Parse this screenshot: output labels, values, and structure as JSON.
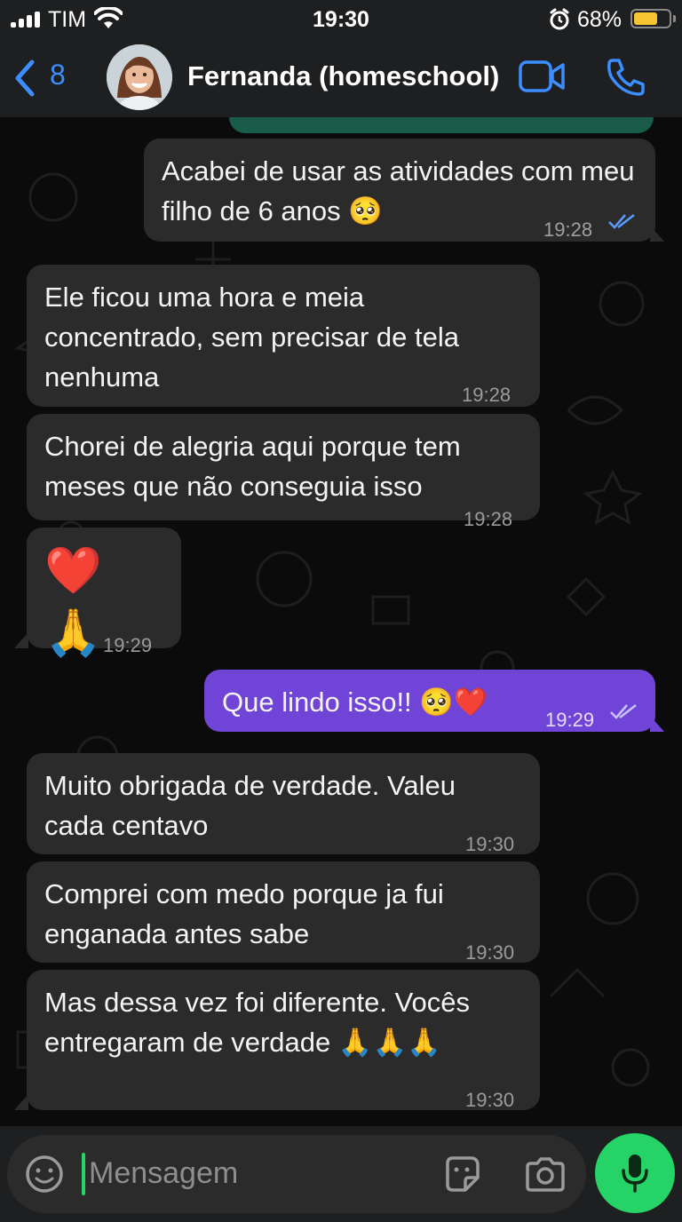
{
  "status_bar": {
    "carrier": "TIM",
    "time": "19:30",
    "battery_percent": "68%",
    "battery_level": 0.68
  },
  "header": {
    "back_count": "8",
    "contact_name": "Fernanda (homeschool)",
    "icons": [
      "chevron-left-icon",
      "video-call-icon",
      "phone-icon"
    ]
  },
  "messages": [
    {
      "direction": "out",
      "text": "Acabei de usar as atividades com meu filho de 6 anos",
      "emoji": "🥺",
      "time": "19:28",
      "status": "read"
    },
    {
      "direction": "in",
      "text": "Ele ficou uma hora e meia concentrado, sem precisar de tela nenhuma",
      "time": "19:28"
    },
    {
      "direction": "in",
      "text": "Chorei de alegria aqui porque tem meses que não conseguia isso",
      "time": "19:28"
    },
    {
      "direction": "in",
      "text": "",
      "emoji": "❤️ 🙏",
      "time": "19:29"
    },
    {
      "direction": "out",
      "text": "Que lindo isso!!",
      "emoji": "🥺❤️",
      "time": "19:29",
      "status": "read",
      "color": "#7044d6"
    },
    {
      "direction": "in",
      "text": "Muito obrigada de verdade. Valeu cada centavo",
      "time": "19:30"
    },
    {
      "direction": "in",
      "text": "Comprei com medo porque ja fui enganada antes sabe",
      "time": "19:30"
    },
    {
      "direction": "in",
      "text": "Mas dessa vez foi diferente. Vocês entregaram de verdade",
      "emoji": "🙏🙏🙏",
      "time": "19:30"
    }
  ],
  "composer": {
    "placeholder": "Mensagem",
    "icons": [
      "sticker-icon",
      "sticker-icon",
      "camera-icon",
      "microphone-icon"
    ]
  },
  "colors": {
    "background": "#0b0b0b",
    "bar": "#1d1f20",
    "bubble": "#2b2b2b",
    "outgoing_highlight": "#7044d6",
    "accent": "#3c8dff",
    "mic": "#25d366",
    "battery": "#f7c531"
  }
}
